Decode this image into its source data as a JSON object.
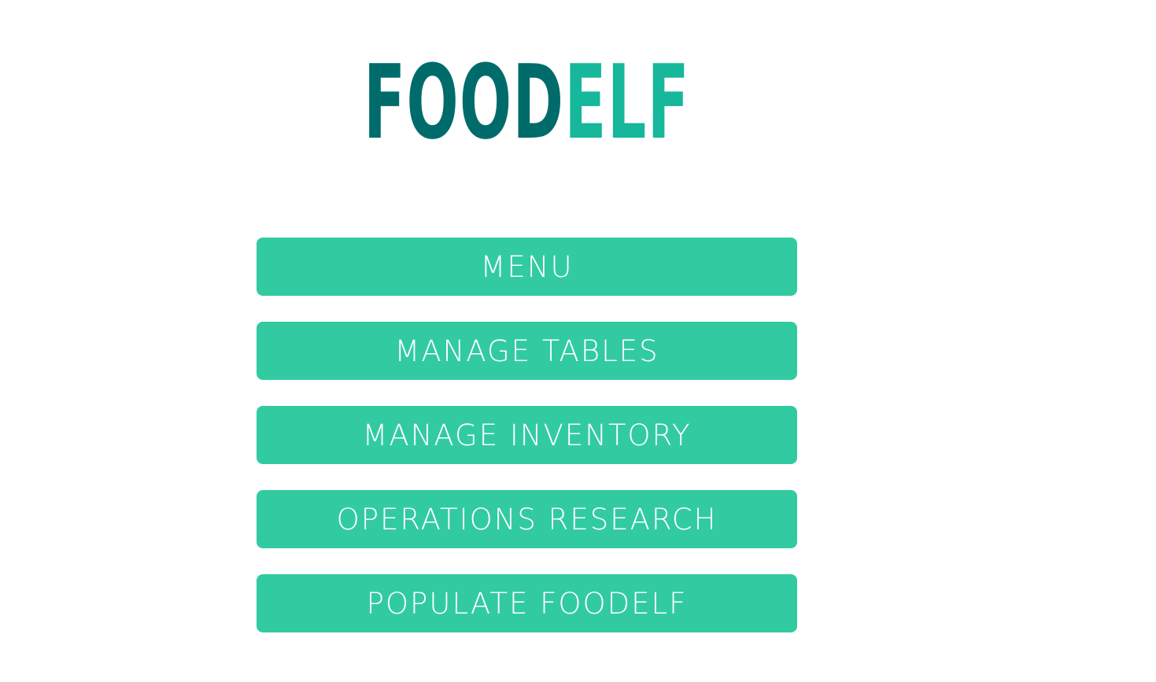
{
  "logo": {
    "part_dark": "FOOD",
    "part_light": "ELF",
    "color_dark": "#006B6B",
    "color_light": "#16B79B"
  },
  "menu": {
    "button_color": "#32CBA1",
    "items": [
      {
        "label": "MENU"
      },
      {
        "label": "MANAGE TABLES"
      },
      {
        "label": "MANAGE INVENTORY"
      },
      {
        "label": "OPERATIONS RESEARCH"
      },
      {
        "label": "POPULATE FOODELF"
      }
    ]
  }
}
